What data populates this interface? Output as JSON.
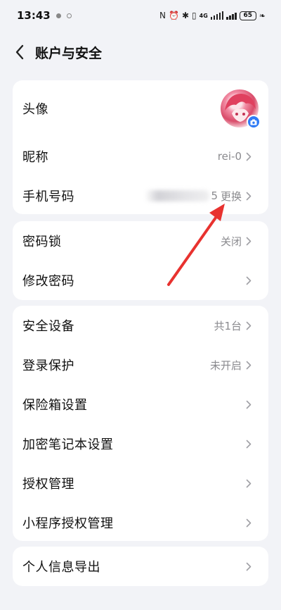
{
  "status_bar": {
    "time": "13:43",
    "network": "4G",
    "battery": "65"
  },
  "header": {
    "title": "账户与安全"
  },
  "section_profile": {
    "avatar_label": "头像",
    "nickname_label": "昵称",
    "nickname_value": "rei-0",
    "phone_label": "手机号码",
    "phone_tail": "5",
    "phone_action": "更换"
  },
  "section_password": {
    "lock_label": "密码锁",
    "lock_value": "关闭",
    "change_password_label": "修改密码"
  },
  "section_security": {
    "devices_label": "安全设备",
    "devices_value": "共1台",
    "login_protect_label": "登录保护",
    "login_protect_value": "未开启",
    "safe_box_label": "保险箱设置",
    "encrypted_notes_label": "加密笔记本设置",
    "auth_manage_label": "授权管理",
    "mini_program_label": "小程序授权管理"
  },
  "section_export": {
    "export_label": "个人信息导出"
  },
  "colors": {
    "background": "#f2f3f7",
    "card": "#ffffff",
    "accent": "#2f7bf5",
    "annotation": "#e8322f",
    "secondary_text": "#8a8a8e"
  }
}
